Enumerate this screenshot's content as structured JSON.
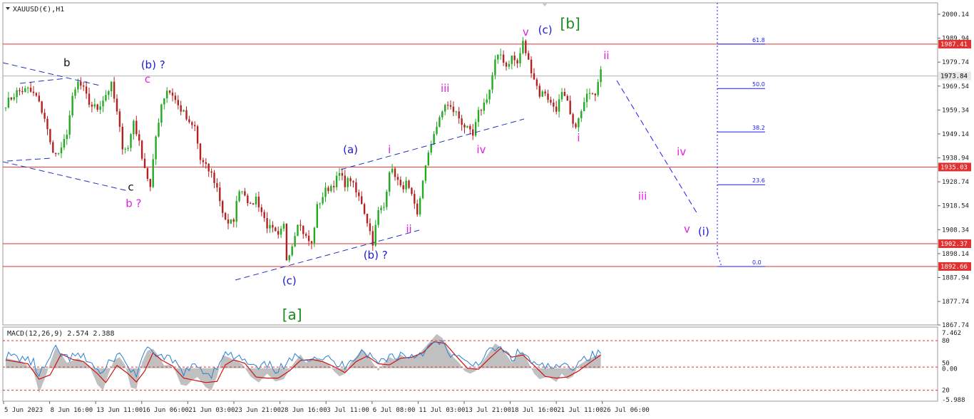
{
  "header": {
    "symbol_label": "XAUUSD(€),H1",
    "indicator_label": "MACD(12,26,9) 2.574 2.388"
  },
  "colors": {
    "bull": "#22aa22",
    "bear": "#b22222",
    "level_line": "#e03030",
    "current_price_line": "#b0b0b0",
    "trend_dashed": "#2233bb",
    "projection_dashed": "#1a1aff",
    "label_black": "#111111",
    "label_blue": "#1a1ad6",
    "label_magenta": "#e020e0",
    "label_green": "#1a8a1a",
    "macd_hist": "#c0c0c0",
    "macd_signal": "#d01010",
    "macd_line": "#2a7fd4",
    "macd_level": "#e03030"
  },
  "chart_data": [
    {
      "type": "candlestick",
      "title": "XAUUSD(€),H1",
      "y_ticks": [
        "2000.14",
        "1989.94",
        "1979.74",
        "1969.54",
        "1959.34",
        "1949.14",
        "1938.94",
        "1928.74",
        "1918.54",
        "1908.34",
        "1898.14",
        "1887.94",
        "1877.74",
        "1867.74"
      ],
      "ylim": [
        1867.74,
        2005.0
      ],
      "x_ticks": [
        "5 Jun 2023",
        "8 Jun 16:00",
        "13 Jun 11:00",
        "16 Jun 06:00",
        "21 Jun 03:00",
        "23 Jun 21:00",
        "28 Jun 16:00",
        "3 Jul 11:00",
        "6 Jul 08:00",
        "11 Jul 03:00",
        "13 Jul 21:00",
        "18 Jul 16:00",
        "21 Jul 11:00",
        "26 Jul 06:00"
      ],
      "price_path": [
        [
          0,
          1962
        ],
        [
          4,
          1967
        ],
        [
          8,
          1968
        ],
        [
          11,
          1965
        ],
        [
          14,
          1956
        ],
        [
          16,
          1945
        ],
        [
          18,
          1940
        ],
        [
          20,
          1942
        ],
        [
          22,
          1950
        ],
        [
          24,
          1964
        ],
        [
          26,
          1971
        ],
        [
          28,
          1968
        ],
        [
          30,
          1962
        ],
        [
          33,
          1960
        ],
        [
          36,
          1966
        ],
        [
          38,
          1970
        ],
        [
          40,
          1958
        ],
        [
          42,
          1944
        ],
        [
          44,
          1943
        ],
        [
          46,
          1955
        ],
        [
          47,
          1950
        ],
        [
          50,
          1935
        ],
        [
          52,
          1926
        ],
        [
          54,
          1948
        ],
        [
          56,
          1962
        ],
        [
          58,
          1968
        ],
        [
          60,
          1966
        ],
        [
          62,
          1961
        ],
        [
          64,
          1958
        ],
        [
          66,
          1953
        ],
        [
          68,
          1952
        ],
        [
          70,
          1938
        ],
        [
          72,
          1935
        ],
        [
          74,
          1932
        ],
        [
          76,
          1926
        ],
        [
          78,
          1916
        ],
        [
          80,
          1910
        ],
        [
          82,
          1913
        ],
        [
          84,
          1926
        ],
        [
          86,
          1924
        ],
        [
          88,
          1918
        ],
        [
          90,
          1922
        ],
        [
          92,
          1916
        ],
        [
          94,
          1910
        ],
        [
          96,
          1908
        ],
        [
          98,
          1905
        ],
        [
          100,
          1910
        ],
        [
          101,
          1896
        ],
        [
          103,
          1902
        ],
        [
          105,
          1912
        ],
        [
          108,
          1905
        ],
        [
          110,
          1902
        ],
        [
          112,
          1918
        ],
        [
          115,
          1925
        ],
        [
          118,
          1928
        ],
        [
          120,
          1932
        ],
        [
          122,
          1928
        ],
        [
          124,
          1930
        ],
        [
          126,
          1924
        ],
        [
          128,
          1920
        ],
        [
          130,
          1912
        ],
        [
          132,
          1903
        ],
        [
          134,
          1916
        ],
        [
          136,
          1918
        ],
        [
          138,
          1934
        ],
        [
          140,
          1932
        ],
        [
          142,
          1926
        ],
        [
          144,
          1928
        ],
        [
          146,
          1922
        ],
        [
          148,
          1914
        ],
        [
          150,
          1930
        ],
        [
          152,
          1940
        ],
        [
          154,
          1950
        ],
        [
          156,
          1955
        ],
        [
          158,
          1962
        ],
        [
          160,
          1960
        ],
        [
          162,
          1958
        ],
        [
          164,
          1954
        ],
        [
          166,
          1951
        ],
        [
          168,
          1948
        ],
        [
          170,
          1958
        ],
        [
          172,
          1962
        ],
        [
          174,
          1968
        ],
        [
          176,
          1980
        ],
        [
          178,
          1983
        ],
        [
          180,
          1978
        ],
        [
          182,
          1982
        ],
        [
          184,
          1979
        ],
        [
          186,
          1988
        ],
        [
          188,
          1980
        ],
        [
          190,
          1973
        ],
        [
          192,
          1966
        ],
        [
          194,
          1967
        ],
        [
          196,
          1962
        ],
        [
          198,
          1960
        ],
        [
          200,
          1966
        ],
        [
          202,
          1962
        ],
        [
          204,
          1952
        ],
        [
          206,
          1955
        ],
        [
          208,
          1962
        ],
        [
          210,
          1968
        ],
        [
          212,
          1967
        ],
        [
          214,
          1978
        ]
      ],
      "levels": [
        {
          "label": "1987.41",
          "value": 1987.41,
          "kind": "resistance"
        },
        {
          "label": "1973.84",
          "value": 1973.84,
          "kind": "current"
        },
        {
          "label": "1935.03",
          "value": 1935.03,
          "kind": "resistance"
        },
        {
          "label": "1902.37",
          "value": 1902.37,
          "kind": "support"
        },
        {
          "label": "1892.66",
          "value": 1892.66,
          "kind": "support"
        }
      ],
      "fib_levels": [
        {
          "label": "61.8",
          "value": 1987.41
        },
        {
          "label": "50.0",
          "value": 1968.5
        },
        {
          "label": "38.2",
          "value": 1950.0
        },
        {
          "label": "23.6",
          "value": 1927.5
        },
        {
          "label": "0.0",
          "value": 1892.66
        }
      ],
      "wave_labels": [
        {
          "text": "b",
          "i": 22,
          "y": 1978,
          "color": "black"
        },
        {
          "text": "(b) ?",
          "i": 53,
          "y": 1977,
          "color": "blue"
        },
        {
          "text": "c",
          "i": 51,
          "y": 1971,
          "color": "magenta"
        },
        {
          "text": "c",
          "i": 45,
          "y": 1925,
          "color": "black"
        },
        {
          "text": "b ?",
          "i": 46,
          "y": 1918,
          "color": "magenta"
        },
        {
          "text": "(c)",
          "i": 102,
          "y": 1885,
          "color": "blue"
        },
        {
          "text": "[a]",
          "i": 103,
          "y": 1870,
          "color": "green"
        },
        {
          "text": "(a)",
          "i": 124,
          "y": 1941,
          "color": "blue"
        },
        {
          "text": "i",
          "i": 138,
          "y": 1941,
          "color": "magenta"
        },
        {
          "text": "ii",
          "i": 145,
          "y": 1907,
          "color": "magenta"
        },
        {
          "text": "(b) ?",
          "i": 133,
          "y": 1896,
          "color": "blue"
        },
        {
          "text": "iii",
          "i": 158,
          "y": 1967,
          "color": "magenta"
        },
        {
          "text": "iv",
          "i": 171,
          "y": 1941,
          "color": "magenta"
        },
        {
          "text": "v",
          "i": 187,
          "y": 1991,
          "color": "magenta"
        },
        {
          "text": "(c)",
          "i": 194,
          "y": 1992,
          "color": "blue"
        },
        {
          "text": "[b]",
          "i": 203,
          "y": 1994,
          "color": "green"
        },
        {
          "text": "i",
          "i": 206,
          "y": 1946,
          "color": "magenta"
        },
        {
          "text": "ii",
          "i": 216,
          "y": 1981,
          "color": "magenta"
        },
        {
          "text": "iv",
          "i": 243,
          "y": 1940,
          "color": "magenta"
        },
        {
          "text": "iii",
          "i": 229,
          "y": 1921,
          "color": "magenta"
        },
        {
          "text": "v",
          "i": 245,
          "y": 1907,
          "color": "magenta"
        },
        {
          "text": "(i)",
          "i": 251,
          "y": 1906,
          "color": "blue"
        }
      ]
    },
    {
      "type": "bar",
      "title": "MACD(12,26,9) 2.574 2.388",
      "y_ticks": [
        "7.462",
        "80",
        "50",
        "0.00",
        "20",
        "-5.988"
      ],
      "ylim": [
        -5.988,
        7.462
      ],
      "macd_path": [
        [
          0,
          1.8
        ],
        [
          6,
          1.2
        ],
        [
          10,
          -0.5
        ],
        [
          12,
          -4.5
        ],
        [
          14,
          -2.0
        ],
        [
          16,
          1.0
        ],
        [
          18,
          3.8
        ],
        [
          20,
          2.5
        ],
        [
          22,
          1.0
        ],
        [
          26,
          1.8
        ],
        [
          30,
          0.5
        ],
        [
          33,
          -3.0
        ],
        [
          35,
          -4.0
        ],
        [
          37,
          -1.0
        ],
        [
          39,
          1.5
        ],
        [
          41,
          2.0
        ],
        [
          43,
          0.5
        ],
        [
          45,
          -3.5
        ],
        [
          47,
          -3.8
        ],
        [
          49,
          1.0
        ],
        [
          51,
          3.2
        ],
        [
          53,
          3.5
        ],
        [
          55,
          2.2
        ],
        [
          57,
          0.5
        ],
        [
          59,
          0.6
        ],
        [
          61,
          -0.5
        ],
        [
          63,
          -3.0
        ],
        [
          65,
          -3.2
        ],
        [
          67,
          -2.2
        ],
        [
          69,
          -1.6
        ],
        [
          72,
          -3.5
        ],
        [
          74,
          -4.0
        ],
        [
          76,
          -1.5
        ],
        [
          78,
          2.4
        ],
        [
          80,
          2.0
        ],
        [
          82,
          1.5
        ],
        [
          85,
          0.8
        ],
        [
          88,
          -1.5
        ],
        [
          91,
          -2.6
        ],
        [
          94,
          -1.0
        ],
        [
          97,
          -2.4
        ],
        [
          100,
          -2.0
        ],
        [
          103,
          0.5
        ],
        [
          106,
          2.5
        ],
        [
          108,
          1.0
        ],
        [
          110,
          1.8
        ],
        [
          113,
          1.5
        ],
        [
          116,
          0.8
        ],
        [
          118,
          -0.5
        ],
        [
          120,
          -1.5
        ],
        [
          122,
          -1.0
        ],
        [
          124,
          1.0
        ],
        [
          126,
          2.0
        ],
        [
          128,
          3.5
        ],
        [
          130,
          2.5
        ],
        [
          132,
          1.0
        ],
        [
          134,
          -0.5
        ],
        [
          136,
          1.0
        ],
        [
          138,
          2.0
        ],
        [
          140,
          1.5
        ],
        [
          142,
          2.5
        ],
        [
          144,
          1.8
        ],
        [
          146,
          2.0
        ],
        [
          149,
          2.8
        ],
        [
          152,
          4.5
        ],
        [
          155,
          6.2
        ],
        [
          157,
          5.5
        ],
        [
          159,
          3.5
        ],
        [
          161,
          2.0
        ],
        [
          163,
          1.0
        ],
        [
          165,
          -0.5
        ],
        [
          167,
          -1.0
        ],
        [
          169,
          -0.5
        ],
        [
          171,
          0.8
        ],
        [
          174,
          3.0
        ],
        [
          176,
          4.5
        ],
        [
          178,
          3.8
        ],
        [
          180,
          2.5
        ],
        [
          182,
          1.0
        ],
        [
          184,
          2.5
        ],
        [
          186,
          3.0
        ],
        [
          188,
          1.0
        ],
        [
          190,
          -1.0
        ],
        [
          192,
          -2.0
        ],
        [
          195,
          -1.5
        ],
        [
          198,
          -2.5
        ],
        [
          200,
          -1.0
        ],
        [
          202,
          -2.0
        ],
        [
          204,
          -1.5
        ],
        [
          206,
          0.5
        ],
        [
          209,
          1.5
        ],
        [
          212,
          2.2
        ],
        [
          214,
          2.574
        ]
      ],
      "signal_path": [
        [
          0,
          1.5
        ],
        [
          8,
          0.8
        ],
        [
          12,
          -2.0
        ],
        [
          16,
          -1.2
        ],
        [
          20,
          2.6
        ],
        [
          24,
          1.6
        ],
        [
          28,
          1.2
        ],
        [
          33,
          -1.0
        ],
        [
          36,
          -2.6
        ],
        [
          40,
          0.5
        ],
        [
          44,
          -1.0
        ],
        [
          47,
          -2.5
        ],
        [
          50,
          -0.5
        ],
        [
          53,
          2.8
        ],
        [
          56,
          1.5
        ],
        [
          60,
          0.4
        ],
        [
          64,
          -1.8
        ],
        [
          68,
          -2.2
        ],
        [
          72,
          -2.6
        ],
        [
          76,
          -2.4
        ],
        [
          79,
          0.6
        ],
        [
          82,
          1.5
        ],
        [
          86,
          0.9
        ],
        [
          90,
          -1.6
        ],
        [
          94,
          -1.8
        ],
        [
          98,
          -1.8
        ],
        [
          102,
          -0.5
        ],
        [
          106,
          1.4
        ],
        [
          110,
          1.6
        ],
        [
          114,
          1.2
        ],
        [
          118,
          0.3
        ],
        [
          122,
          -0.8
        ],
        [
          126,
          1.2
        ],
        [
          130,
          2.2
        ],
        [
          134,
          0.8
        ],
        [
          138,
          0.6
        ],
        [
          142,
          1.8
        ],
        [
          146,
          2.0
        ],
        [
          150,
          2.8
        ],
        [
          154,
          4.8
        ],
        [
          158,
          4.5
        ],
        [
          162,
          2.2
        ],
        [
          166,
          0.0
        ],
        [
          170,
          -0.2
        ],
        [
          174,
          1.8
        ],
        [
          178,
          3.6
        ],
        [
          182,
          2.0
        ],
        [
          186,
          2.4
        ],
        [
          190,
          0.5
        ],
        [
          194,
          -1.5
        ],
        [
          198,
          -1.8
        ],
        [
          202,
          -1.6
        ],
        [
          206,
          -0.5
        ],
        [
          210,
          1.0
        ],
        [
          214,
          2.388
        ]
      ]
    }
  ]
}
